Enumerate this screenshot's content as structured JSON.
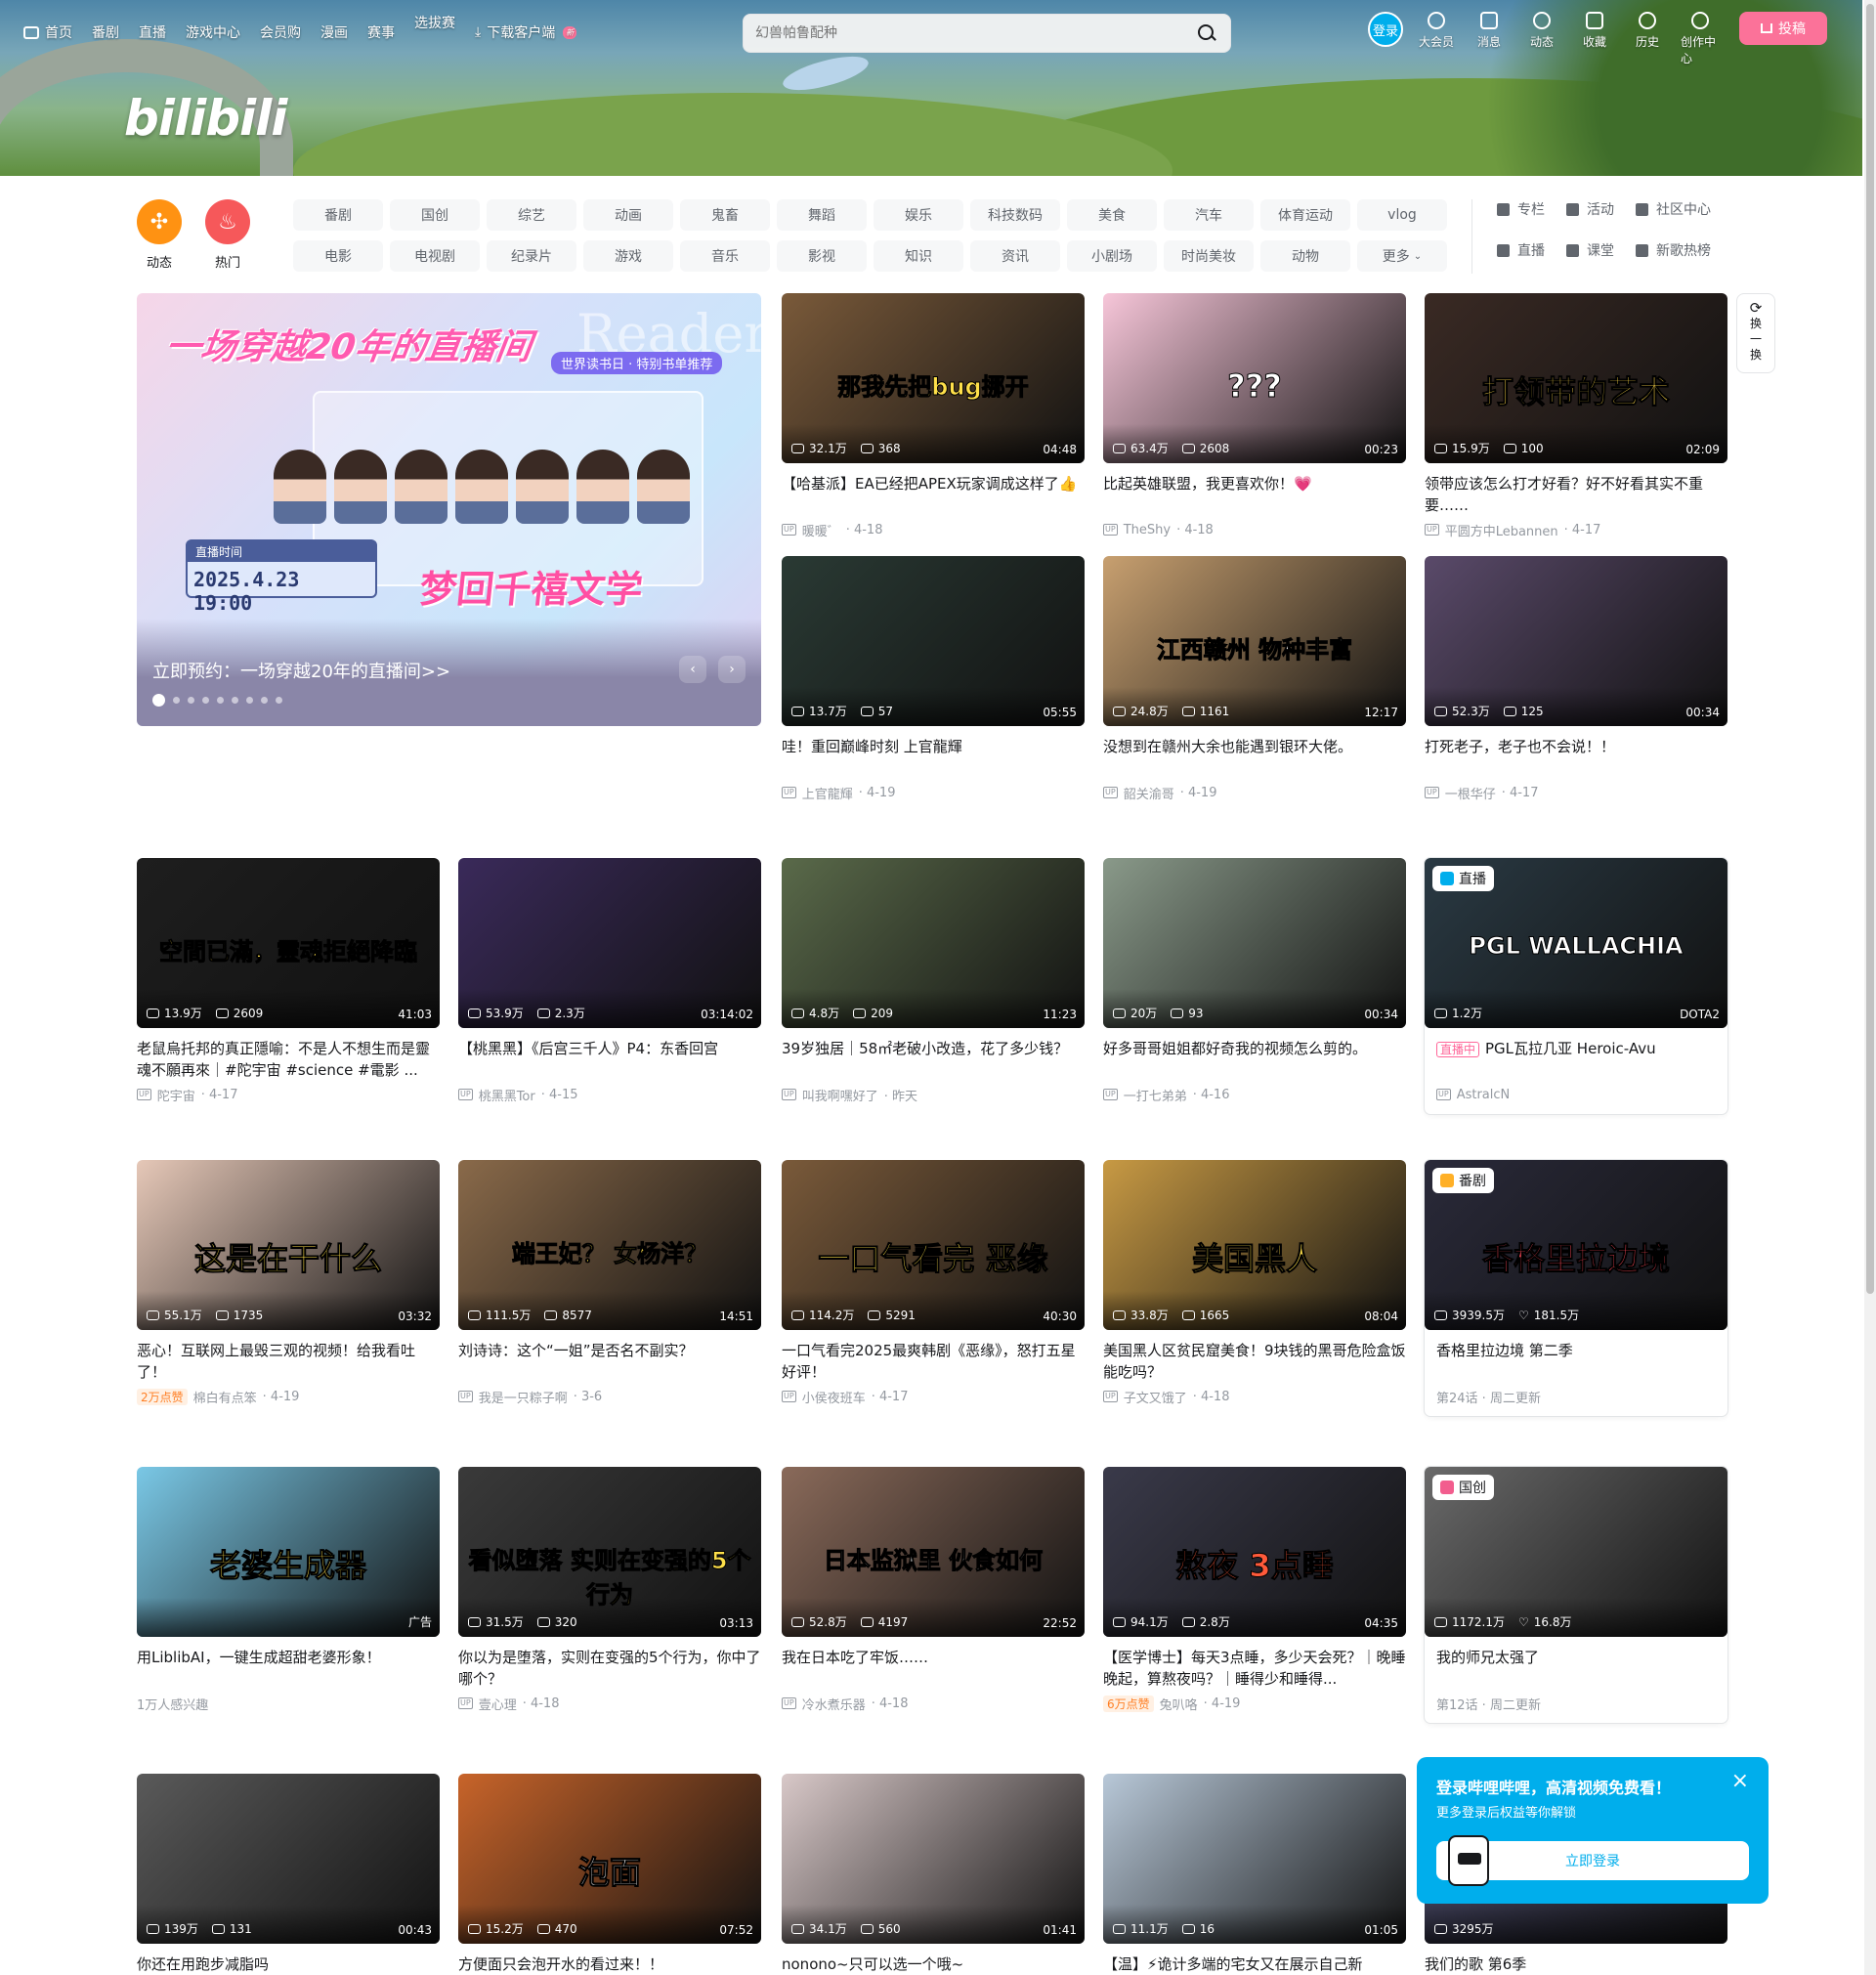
{
  "nav": {
    "home": "首页",
    "items": [
      "番剧",
      "直播",
      "游戏中心",
      "会员购",
      "漫画",
      "赛事"
    ],
    "raised_item": "选拔赛",
    "download": "下载客户端",
    "download_badge": "新"
  },
  "logo": "bilibili",
  "search": {
    "placeholder": "幻兽帕鲁配种"
  },
  "user": {
    "login": "登录",
    "items": [
      "大会员",
      "消息",
      "动态",
      "收藏",
      "历史",
      "创作中心"
    ],
    "upload": "投稿"
  },
  "channels": {
    "dynamic": "动态",
    "hot": "热门",
    "row1": [
      "番剧",
      "国创",
      "综艺",
      "动画",
      "鬼畜",
      "舞蹈",
      "娱乐",
      "科技数码",
      "美食",
      "汽车",
      "体育运动",
      "vlog"
    ],
    "row2": [
      "电影",
      "电视剧",
      "纪录片",
      "游戏",
      "音乐",
      "影视",
      "知识",
      "资讯",
      "小剧场",
      "时尚美妆",
      "动物",
      "更多"
    ],
    "side": [
      "专栏",
      "活动",
      "社区中心",
      "直播",
      "课堂",
      "新歌热榜"
    ]
  },
  "hero": {
    "title": "一场穿越20年的直播间",
    "subtitle": "世界读书日 · 特别书单推荐",
    "bg_word": "Reader",
    "time_label": "直播时间",
    "time": "2025.4.23 19:00",
    "brand": "梦回千禧文学",
    "caption": "立即预约：一场穿越20年的直播间>>",
    "prev": "‹",
    "next": "›",
    "dots": 9
  },
  "refresh": {
    "label1": "换",
    "label2": "一",
    "label3": "换"
  },
  "cards": [
    {
      "views": "32.1万",
      "danmaku": "368",
      "duration": "04:48",
      "title": "【哈基派】EA已经把APEX玩家调成这样了👍",
      "author": "暖暖゛",
      "date": "4-18",
      "overlay": "那我先把bug挪开",
      "bg": "#7a5a3a",
      "ov_color": "#ffe04a"
    },
    {
      "views": "63.4万",
      "danmaku": "2608",
      "duration": "00:23",
      "title": "比起英雄联盟，我更喜欢你！💗",
      "author": "TheShy",
      "date": "4-18",
      "overlay": "???",
      "bg": "#f7c6d9",
      "ov_color": "#ffffff"
    },
    {
      "views": "15.9万",
      "danmaku": "100",
      "duration": "02:09",
      "title": "领带应该怎么打才好看？好不好看其实不重要……",
      "author": "平圆方中Lebannen",
      "date": "4-17",
      "overlay": "打领带的艺术",
      "bg": "#3a2a24",
      "ov_color": "#ffd84a"
    },
    {
      "views": "13.7万",
      "danmaku": "57",
      "duration": "05:55",
      "title": "哇！重回巅峰时刻 上官龍輝",
      "author": "上官龍輝",
      "date": "4-19",
      "overlay": "",
      "bg": "#2a3a34",
      "ov_color": "#ffffff"
    },
    {
      "views": "24.8万",
      "danmaku": "1161",
      "duration": "12:17",
      "title": "没想到在赣州大余也能遇到银环大佬。",
      "author": "韶关渝哥",
      "date": "4-19",
      "overlay": "江西赣州 物种丰富",
      "bg": "#c8a070",
      "ov_color": "#ffffff"
    },
    {
      "views": "52.3万",
      "danmaku": "125",
      "duration": "00:34",
      "title": "打死老子，老子也不会说！！",
      "author": "一根华仔",
      "date": "4-17",
      "overlay": "",
      "bg": "#5a4a6a",
      "ov_color": "#ffffff"
    },
    {
      "views": "13.9万",
      "danmaku": "2609",
      "duration": "41:03",
      "title": "老鼠烏托邦的真正隱喻：不是人不想生而是靈魂不願再來｜#陀宇宙 #science #電影 ...",
      "author": "陀宇宙",
      "date": "4-17",
      "overlay": "空間已滿，靈魂拒絕降臨",
      "bg": "#1e1e1e",
      "ov_color": "#ffe04a"
    },
    {
      "views": "53.9万",
      "danmaku": "2.3万",
      "duration": "03:14:02",
      "title": "【桃黑黑】《后宫三千人》P4：东香回宫",
      "author": "桃黑黑Tor",
      "date": "4-15",
      "overlay": "",
      "bg": "#3a2a5a",
      "ov_color": "#ffffff"
    },
    {
      "views": "4.8万",
      "danmaku": "209",
      "duration": "11:23",
      "title": "39岁独居｜58㎡老破小改造，花了多少钱？",
      "author": "叫我啊嘿好了",
      "date": "昨天",
      "overlay": "",
      "bg": "#5a6a4a",
      "ov_color": "#ffffff"
    },
    {
      "views": "20万",
      "danmaku": "93",
      "duration": "00:34",
      "title": "好多哥哥姐姐都好奇我的视频怎么剪的。",
      "author": "一打七弟弟",
      "date": "4-16",
      "overlay": "",
      "bg": "#8a9a8a",
      "ov_color": "#ffffff"
    },
    {
      "views": "1.2万",
      "danmaku": "",
      "duration": "DOTA2",
      "title": "PGL瓦拉几亚 Heroic-Avu",
      "author": "AstralcN",
      "date": "",
      "overlay": "PGL WALLACHIA",
      "bg": "#2a3a44",
      "ov_color": "#ffffff",
      "tag": "直播",
      "live": "直播中"
    },
    {
      "views": "55.1万",
      "danmaku": "1735",
      "duration": "03:32",
      "title": "恶心！互联网上最毁三观的视频！给我看吐了！",
      "author": "棉白有点笨",
      "date": "4-19",
      "overlay": "这是在干什么",
      "bg": "#e6c8b8",
      "ov_color": "#ffe04a",
      "hot": "2万点赞"
    },
    {
      "views": "111.5万",
      "danmaku": "8577",
      "duration": "14:51",
      "title": "刘诗诗：这个“一姐”是否名不副实？",
      "author": "我是一只粽子啊",
      "date": "3-6",
      "overlay": "端王妃？ 女杨洋？",
      "bg": "#8a6a4a",
      "ov_color": "#ffe04a"
    },
    {
      "views": "114.2万",
      "danmaku": "5291",
      "duration": "40:30",
      "title": "一口气看完2025最爽韩剧《恶缘》，怒打五星好评！",
      "author": "小侯夜班车",
      "date": "4-17",
      "overlay": "一口气看完 恶缘",
      "bg": "#7a5a3a",
      "ov_color": "#ffe04a"
    },
    {
      "views": "33.8万",
      "danmaku": "1665",
      "duration": "08:04",
      "title": "美国黑人区贫民窟美食！9块钱的黑哥危险盒饭能吃吗？",
      "author": "子文又饿了",
      "date": "4-18",
      "overlay": "美国黑人",
      "bg": "#c89a44",
      "ov_color": "#ffe04a"
    },
    {
      "views": "3939.5万",
      "danmaku": "181.5万",
      "duration": "",
      "title": "香格里拉边境 第二季",
      "author": "",
      "date": "第24话 · 周二更新",
      "overlay": "香格里拉边境",
      "bg": "#2a2a3a",
      "ov_color": "#ff4a5a",
      "tag": "番剧",
      "like_icon": true
    },
    {
      "views": "",
      "danmaku": "",
      "duration": "广告",
      "title": "用LiblibAI，一键生成超甜老婆形象！",
      "author": "",
      "date": "1万人感兴趣",
      "overlay": "老婆生成器",
      "bg": "#7ac8e6",
      "ov_color": "#ffe04a",
      "ad": true
    },
    {
      "views": "31.5万",
      "danmaku": "320",
      "duration": "03:13",
      "title": "你以为是堕落，实则在变强的5个行为，你中了哪个？",
      "author": "壹心理",
      "date": "4-18",
      "overlay": "看似堕落 实则在变强的5个行为",
      "bg": "#3a3a3a",
      "ov_color": "#ffe04a"
    },
    {
      "views": "52.8万",
      "danmaku": "4197",
      "duration": "22:52",
      "title": "我在日本吃了牢饭……",
      "author": "冷水煮乐器",
      "date": "4-18",
      "overlay": "日本监狱里 伙食如何",
      "bg": "#8a6a5a",
      "ov_color": "#ffffff"
    },
    {
      "views": "94.1万",
      "danmaku": "2.8万",
      "duration": "04:35",
      "title": "【医学博士】每天3点睡，多少天会死？｜晚睡晚起，算熬夜吗？｜睡得少和睡得...",
      "author": "兔叭咯",
      "date": "4-19",
      "overlay": "熬夜 3点睡",
      "bg": "#3a3a4a",
      "ov_color": "#ff5a3a",
      "hot": "6万点赞"
    },
    {
      "views": "1172.1万",
      "danmaku": "16.8万",
      "duration": "",
      "title": "我的师兄太强了",
      "author": "",
      "date": "第12话 · 周二更新",
      "overlay": "",
      "bg": "#6a6a6a",
      "ov_color": "#ffffff",
      "tag": "国创",
      "like_icon": true
    },
    {
      "views": "139万",
      "danmaku": "131",
      "duration": "00:43",
      "title": "你还在用跑步减脂吗",
      "author": "",
      "date": "",
      "overlay": "",
      "bg": "#5a5a5a",
      "ov_color": "#ffffff"
    },
    {
      "views": "15.2万",
      "danmaku": "470",
      "duration": "07:52",
      "title": "方便面只会泡开水的看过来！！",
      "author": "",
      "date": "",
      "overlay": "泡面",
      "bg": "#c8642a",
      "ov_color": "#ffffff"
    },
    {
      "views": "34.1万",
      "danmaku": "560",
      "duration": "01:41",
      "title": "nonono~只可以选一个哦~",
      "author": "",
      "date": "",
      "overlay": "",
      "bg": "#d8c8c8",
      "ov_color": "#ffffff"
    },
    {
      "views": "11.1万",
      "danmaku": "16",
      "duration": "01:05",
      "title": "【温】⚡诡计多端的宅女又在展示自己新",
      "author": "",
      "date": "",
      "overlay": "",
      "bg": "#b8c8d8",
      "ov_color": "#ffffff"
    },
    {
      "views": "3295万",
      "danmaku": "",
      "duration": "",
      "title": "我们的歌 第6季",
      "author": "",
      "date": "",
      "overlay": "",
      "bg": "#4a4a6a",
      "ov_color": "#ffffff"
    }
  ],
  "popup": {
    "title": "登录哔哩哔哩，高清视频免费看！",
    "subtitle": "更多登录后权益等你解锁",
    "button": "立即登录",
    "close": "×"
  }
}
